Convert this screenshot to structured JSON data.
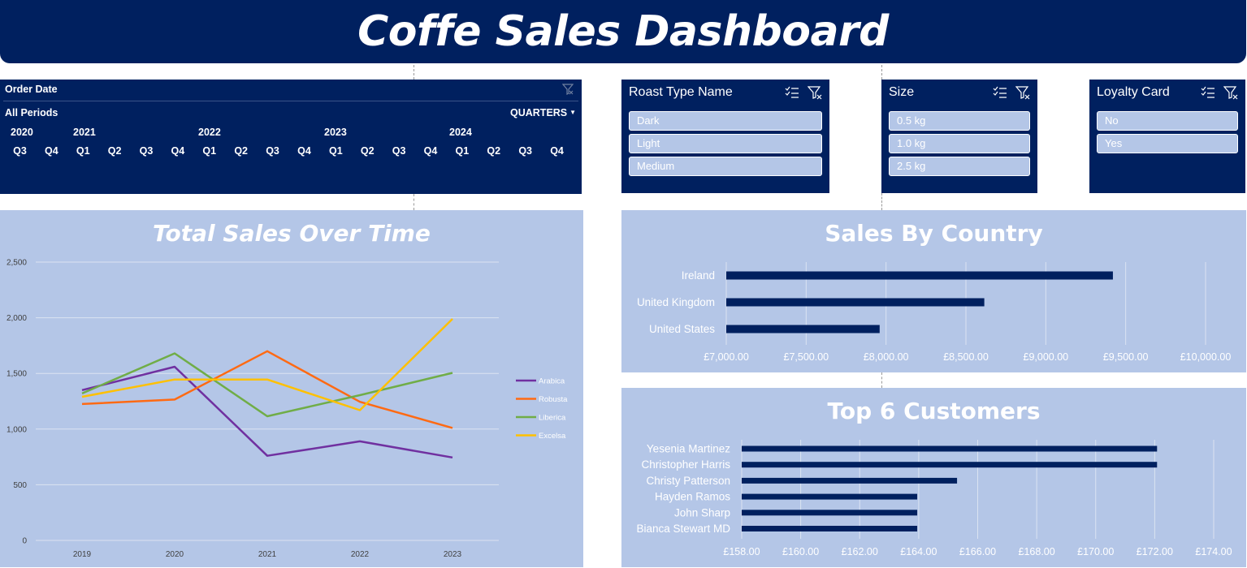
{
  "title": "Coffe Sales Dashboard",
  "timeline": {
    "title": "Order Date",
    "periods_label": "All Periods",
    "level_label": "QUARTERS",
    "years": [
      "2020",
      "2021",
      "2022",
      "2023",
      "2024"
    ],
    "quarters": [
      "Q3",
      "Q4",
      "Q1",
      "Q2",
      "Q3",
      "Q4",
      "Q1",
      "Q2",
      "Q3",
      "Q4",
      "Q1",
      "Q2",
      "Q3",
      "Q4",
      "Q1",
      "Q2",
      "Q3",
      "Q4"
    ],
    "clear_icon": "filter-clear-icon"
  },
  "slicers": [
    {
      "title": "Roast Type Name",
      "items": [
        "Dark",
        "Light",
        "Medium"
      ]
    },
    {
      "title": "Size",
      "items": [
        "0.5 kg",
        "1.0 kg",
        "2.5 kg"
      ]
    },
    {
      "title": "Loyalty Card",
      "items": [
        "No",
        "Yes"
      ]
    }
  ],
  "colors": {
    "navy": "#00205f",
    "panel": "#b4c6e7",
    "arabica": "#7030a0",
    "robusta": "#ff6a13",
    "liberica": "#70ad47",
    "excelsa": "#ffc000"
  },
  "chart_data": [
    {
      "type": "line",
      "title": "Total Sales Over Time",
      "x": [
        "2019",
        "2020",
        "2021",
        "2022",
        "2023"
      ],
      "ylim": [
        0,
        2500
      ],
      "yticks": [
        "0",
        "500",
        "1,000",
        "1,500",
        "2,000",
        "2,500"
      ],
      "legend": "right",
      "grid": true,
      "series": [
        {
          "name": "Arabica",
          "values": [
            1350,
            1560,
            760,
            890,
            745
          ]
        },
        {
          "name": "Robusta",
          "values": [
            1225,
            1265,
            1700,
            1245,
            1010
          ]
        },
        {
          "name": "Liberica",
          "values": [
            1320,
            1680,
            1115,
            1305,
            1505
          ]
        },
        {
          "name": "Excelsa",
          "values": [
            1290,
            1445,
            1445,
            1170,
            1990
          ]
        }
      ]
    },
    {
      "type": "bar",
      "orientation": "horizontal",
      "title": "Sales By Country",
      "categories": [
        "Ireland",
        "United Kingdom",
        "United States"
      ],
      "values": [
        9420,
        8615,
        7960
      ],
      "xlim": [
        7000,
        10000
      ],
      "xticks": [
        "£7,000.00",
        "£7,500.00",
        "£8,000.00",
        "£8,500.00",
        "£9,000.00",
        "£9,500.00",
        "£10,000.00"
      ],
      "grid": true
    },
    {
      "type": "bar",
      "orientation": "horizontal",
      "title": "Top 6 Customers",
      "categories": [
        "Yesenia Martinez",
        "Christopher Harris",
        "Christy Patterson",
        "Hayden Ramos",
        "John Sharp",
        "Bianca Stewart MD"
      ],
      "values": [
        172.08,
        172.08,
        165.3,
        163.95,
        163.95,
        163.95
      ],
      "xlim": [
        158,
        174
      ],
      "xticks": [
        "£158.00",
        "£160.00",
        "£162.00",
        "£164.00",
        "£166.00",
        "£168.00",
        "£170.00",
        "£172.00",
        "£174.00"
      ],
      "grid": true
    }
  ]
}
